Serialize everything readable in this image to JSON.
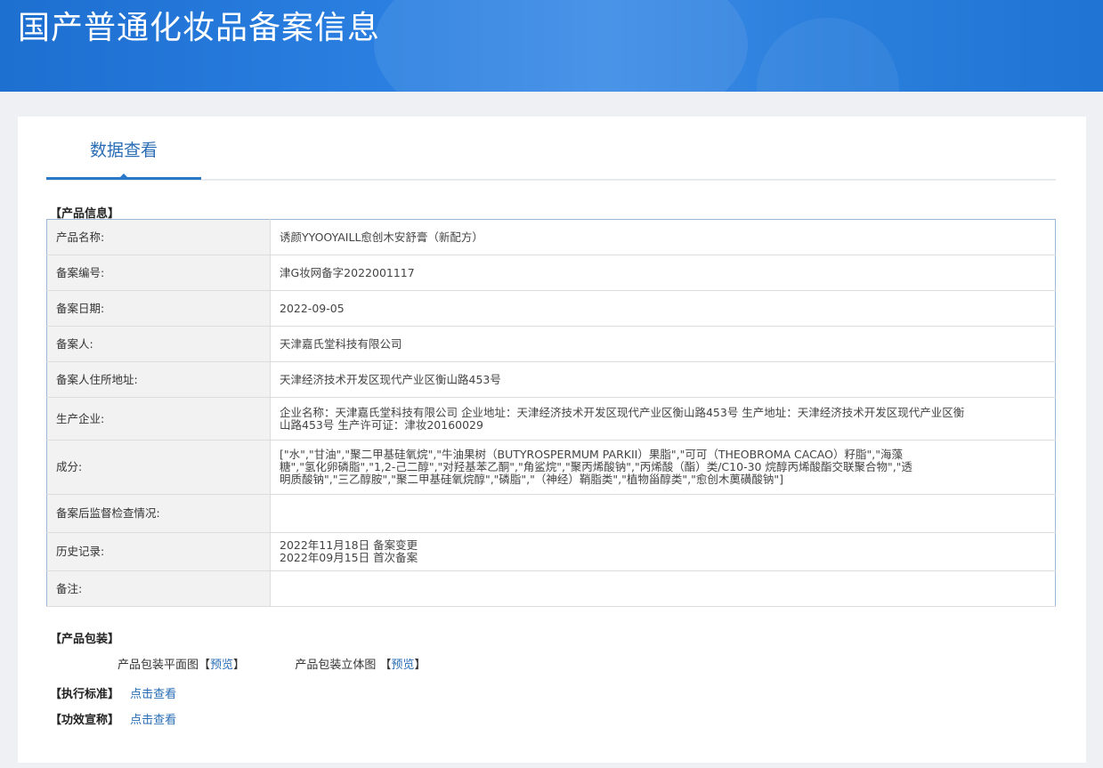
{
  "header": {
    "title": "国产普通化妆品备案信息"
  },
  "tabs": [
    {
      "label": "数据查看"
    }
  ],
  "product_section": {
    "label": "【产品信息】"
  },
  "rows": [
    {
      "key": "产品名称:",
      "lines": [
        "诱颜YYOOYAILL愈创木安舒膏（新配方）"
      ]
    },
    {
      "key": "备案编号:",
      "lines": [
        "津G妆网备字2022001117"
      ]
    },
    {
      "key": "备案日期:",
      "lines": [
        "2022-09-05"
      ]
    },
    {
      "key": "备案人:",
      "lines": [
        "天津嘉氏堂科技有限公司"
      ]
    },
    {
      "key": "备案人住所地址:",
      "lines": [
        "天津经济技术开发区现代产业区衡山路453号"
      ]
    },
    {
      "key": "生产企业:",
      "lines": [
        "企业名称：天津嘉氏堂科技有限公司 企业地址：天津经济技术开发区现代产业区衡山路453号 生产地址：天津经济技术开发区现代产业区衡",
        "山路453号 生产许可证：津妆20160029"
      ]
    },
    {
      "key": "成分:",
      "lines": [
        "[\"水\",\"甘油\",\"聚二甲基硅氧烷\",\"牛油果树（BUTYROSPERMUM PARKII）果脂\",\"可可（THEOBROMA CACAO）籽脂\",\"海藻",
        "糖\",\"氢化卵磷脂\",\"1,2-己二醇\",\"对羟基苯乙酮\",\"角鲨烷\",\"聚丙烯酸钠\",\"丙烯酸（酯）类/C10-30 烷醇丙烯酸酯交联聚合物\",\"透",
        "明质酸钠\",\"三乙醇胺\",\"聚二甲基硅氧烷醇\",\"磷脂\",\"（神经）鞘脂类\",\"植物甾醇类\",\"愈创木薁磺酸钠\"]"
      ]
    },
    {
      "key": "备案后监督检查情况:",
      "lines": [
        ""
      ]
    },
    {
      "key": "历史记录:",
      "lines": [
        "2022年11月18日 备案变更",
        "2022年09月15日 首次备案"
      ]
    },
    {
      "key": "备注:",
      "lines": [
        ""
      ]
    }
  ],
  "packaging": {
    "label": "【产品包装】",
    "flat_label": "产品包装平面图",
    "flat_open": "【",
    "flat_link": "预览",
    "flat_close": "】",
    "solid_label": "产品包装立体图",
    "solid_open": "【",
    "solid_link": "预览",
    "solid_close": "】"
  },
  "standard": {
    "label": "【执行标准】",
    "link": "点击查看"
  },
  "efficacy": {
    "label": "【功效宣称】",
    "link": "点击查看"
  }
}
